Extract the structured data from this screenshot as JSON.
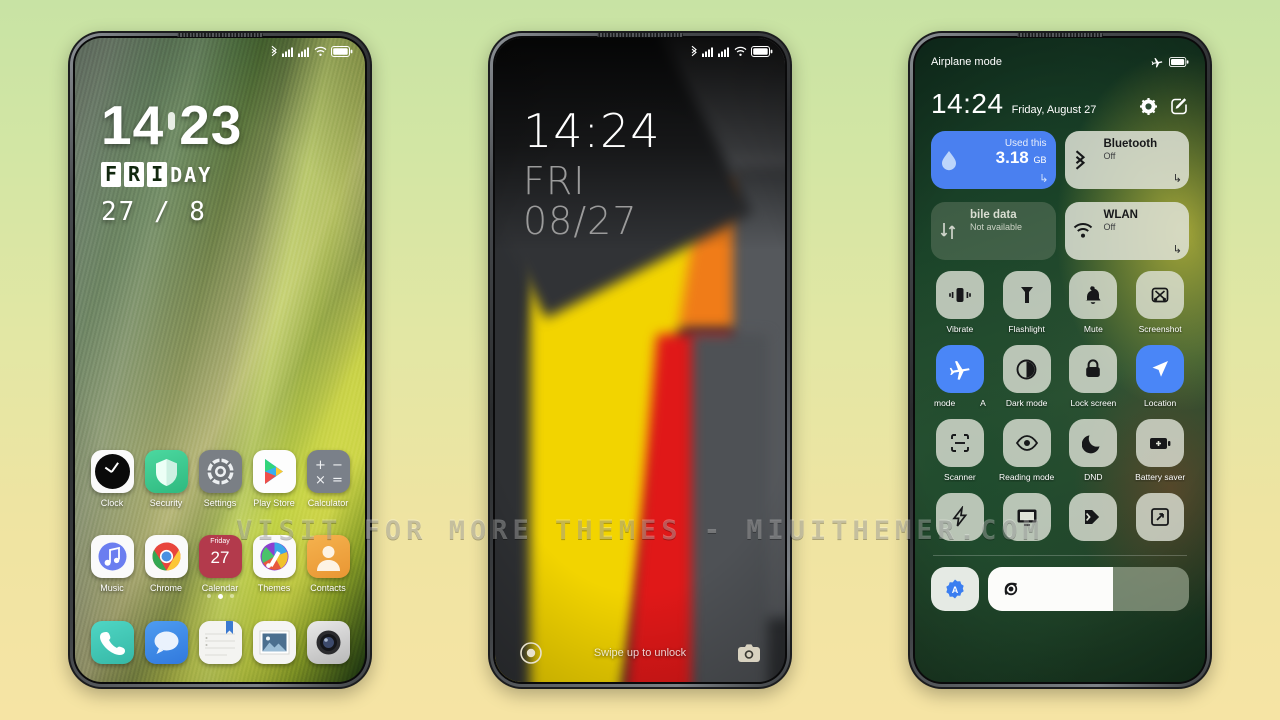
{
  "background": {
    "top_color": "#c8e3a4",
    "bottom_color": "#f6e4a4"
  },
  "watermark": {
    "text": "VISIT FOR MORE  THEMES  -  MIUITHEMER.COM"
  },
  "phone1": {
    "status_bar": {
      "icons": [
        "bluetooth-icon",
        "signal-icon-1",
        "signal-icon-2",
        "wifi-icon",
        "battery-icon"
      ]
    },
    "clock": {
      "hours": "14",
      "minutes": "23",
      "day_boxed": "FRI",
      "day_plain": "DAY",
      "date": "27 / 8"
    },
    "apps_row1": [
      {
        "label": "Clock",
        "icon": "clock-icon"
      },
      {
        "label": "Security",
        "icon": "shield-icon"
      },
      {
        "label": "Settings",
        "icon": "gear-icon"
      },
      {
        "label": "Play Store",
        "icon": "play-store-icon"
      },
      {
        "label": "Calculator",
        "icon": "calculator-icon"
      }
    ],
    "apps_row2": [
      {
        "label": "Music",
        "icon": "music-note-icon"
      },
      {
        "label": "Chrome",
        "icon": "chrome-icon"
      },
      {
        "label": "Calendar",
        "icon": "calendar-icon",
        "weekday": "Friday",
        "day": "27"
      },
      {
        "label": "Themes",
        "icon": "themes-icon"
      },
      {
        "label": "Contacts",
        "icon": "contacts-icon"
      }
    ],
    "page_dots": {
      "count": 3,
      "active_index": 1
    },
    "dock": [
      {
        "label": "Phone",
        "icon": "phone-icon"
      },
      {
        "label": "Messages",
        "icon": "message-bubble-icon"
      },
      {
        "label": "Notes",
        "icon": "notes-icon"
      },
      {
        "label": "Gallery",
        "icon": "gallery-icon"
      },
      {
        "label": "Camera",
        "icon": "camera-icon"
      }
    ]
  },
  "phone2": {
    "status_bar": {
      "icons": [
        "bluetooth-icon",
        "signal-icon-1",
        "signal-icon-2",
        "wifi-icon",
        "battery-icon"
      ]
    },
    "lock": {
      "time": "14:24",
      "weekday": "FRI",
      "date": "08/27",
      "hint": "Swipe up to unlock",
      "left_shortcut": "record-icon",
      "right_shortcut": "camera-icon"
    }
  },
  "phone3": {
    "status_bar": {
      "left_text": "Airplane mode",
      "icons": [
        "airplane-icon",
        "battery-icon"
      ]
    },
    "header": {
      "time": "14:24",
      "date": "Friday, August 27",
      "settings_icon": "gear-icon",
      "edit_icon": "edit-pencil-icon"
    },
    "big_tiles": [
      {
        "name": "data-usage",
        "state": "on",
        "top_label": "Used this",
        "value": "3.18",
        "unit": "GB",
        "icon": "water-drop-icon"
      },
      {
        "name": "bluetooth",
        "state": "off",
        "title": "Bluetooth",
        "sub": "Off",
        "icon": "bluetooth-icon"
      },
      {
        "name": "mobile-data",
        "state": "unavailable",
        "title": "bile data",
        "sub": "Not available",
        "icon": "data-transfer-icon"
      },
      {
        "name": "wlan",
        "state": "off",
        "title": "WLAN",
        "sub": "Off",
        "icon": "wifi-icon"
      }
    ],
    "tiles_row1": [
      {
        "label": "Vibrate",
        "icon": "vibrate-icon",
        "on": false
      },
      {
        "label": "Flashlight",
        "icon": "flashlight-icon",
        "on": false
      },
      {
        "label": "Mute",
        "icon": "bell-icon",
        "on": false
      },
      {
        "label": "Screenshot",
        "icon": "screenshot-scissors-icon",
        "on": false
      }
    ],
    "tiles_row2": [
      {
        "label": "mode",
        "label_right": "A",
        "icon": "airplane-icon",
        "on": true
      },
      {
        "label": "Dark mode",
        "icon": "contrast-circle-icon",
        "on": false
      },
      {
        "label": "Lock screen",
        "icon": "padlock-icon",
        "on": false
      },
      {
        "label": "Location",
        "icon": "location-arrow-icon",
        "on": true
      }
    ],
    "tiles_row3": [
      {
        "label": "Scanner",
        "icon": "scan-frame-icon",
        "on": false
      },
      {
        "label": "Reading mode",
        "icon": "eye-icon",
        "on": false
      },
      {
        "label": "DND",
        "icon": "moon-icon",
        "on": false
      },
      {
        "label": "Battery saver",
        "icon": "battery-plus-icon",
        "on": false
      }
    ],
    "tiles_row4": [
      {
        "label": "",
        "icon": "lightning-bolt-icon",
        "on": false
      },
      {
        "label": "",
        "icon": "cast-screen-icon",
        "on": false
      },
      {
        "label": "",
        "icon": "video-toolbox-icon",
        "on": false
      },
      {
        "label": "",
        "icon": "expand-arrows-icon",
        "on": false
      }
    ],
    "brightness": {
      "auto_label": "A",
      "auto_icon": "auto-brightness-icon",
      "slider_icon": "brightness-icon",
      "level_percent": 62
    }
  }
}
